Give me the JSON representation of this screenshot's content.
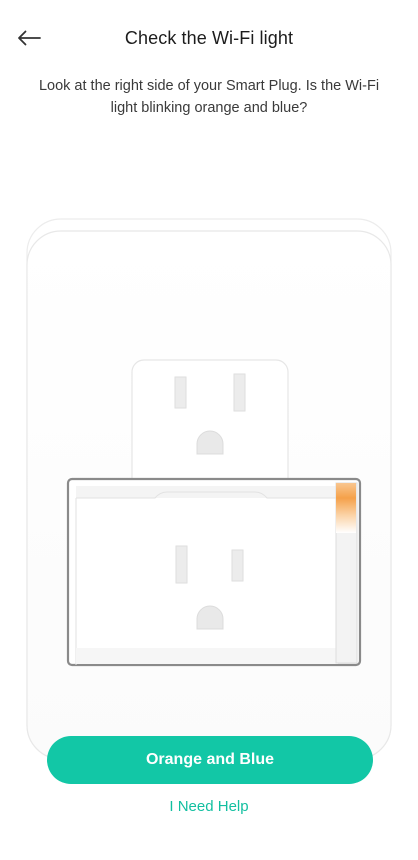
{
  "header": {
    "back_icon": "arrow-left-icon",
    "title": "Check the Wi-Fi light"
  },
  "instructions": "Look at the right side of your Smart Plug. Is the Wi-Fi light blinking orange and blue?",
  "illustration": {
    "subject": "smart-plug-in-wall-outlet",
    "led_colors": [
      "#f5a14a",
      "#ffffff"
    ]
  },
  "actions": {
    "primary_label": "Orange and Blue",
    "help_label": "I Need Help"
  },
  "colors": {
    "accent": "#12c7a6",
    "led_orange": "#f5a14a"
  }
}
